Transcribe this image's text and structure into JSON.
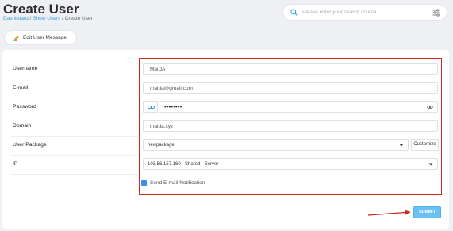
{
  "header": {
    "title": "Create User",
    "breadcrumb": {
      "dashboard": "Dashboard",
      "sep1": " / ",
      "users": "Show Users",
      "sep2": " / ",
      "current": "Create User"
    }
  },
  "search": {
    "placeholder": "Please enter your search criteria"
  },
  "toolbar": {
    "edit_message_label": "Edit User Message"
  },
  "form": {
    "labels": {
      "username": "Username",
      "email": "E-mail",
      "password": "Password",
      "domain": "Domain",
      "package": "User Package",
      "ip": "IP"
    },
    "values": {
      "username": "MaiDA",
      "email": "maida@gmail.com",
      "password": "••••••••",
      "domain": "maida.xyz",
      "package": "newpackage",
      "ip": "103.56.157.160 - Shared - Server"
    },
    "customize_label": "Customize",
    "notify_label": "Send E-mail Notification",
    "notify_checked": true,
    "submit_label": "SUBMIT"
  },
  "colors": {
    "accent": "#3aa0d8",
    "highlight_box": "#d6261e",
    "submit_bg": "#6cc1f4",
    "checkbox": "#3b8fe6"
  },
  "icons": {
    "search": "search-icon",
    "filter": "sliders-icon",
    "edit": "pencil-icon",
    "password_generate": "link-icon",
    "password_reveal": "eye-icon",
    "dropdown": "chevron-down-icon",
    "annotation": "red-arrow-icon"
  }
}
